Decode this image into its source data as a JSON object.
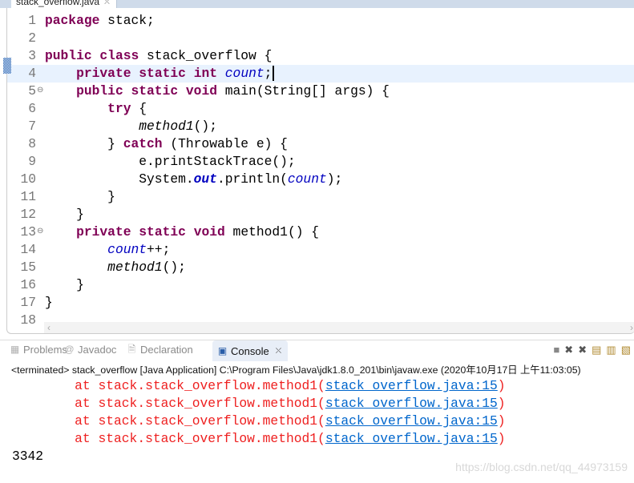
{
  "editor_tab": {
    "title": "stack_overflow.java",
    "close": "⛌"
  },
  "code": [
    {
      "n": "1",
      "t": [
        [
          "package",
          "kw"
        ],
        [
          " stack;",
          ""
        ]
      ]
    },
    {
      "n": "2",
      "t": []
    },
    {
      "n": "3",
      "t": [
        [
          "public",
          "kw"
        ],
        [
          " ",
          ""
        ],
        [
          "class",
          "kw"
        ],
        [
          " stack_overflow {",
          ""
        ]
      ]
    },
    {
      "n": "4",
      "cur": true,
      "t": [
        [
          "    ",
          ""
        ],
        [
          "private",
          "kw"
        ],
        [
          " ",
          ""
        ],
        [
          "static",
          "kw"
        ],
        [
          " ",
          ""
        ],
        [
          "int",
          "kw"
        ],
        [
          " ",
          ""
        ],
        [
          "count",
          "fld"
        ],
        [
          ";",
          ""
        ]
      ]
    },
    {
      "n": "5",
      "fold": true,
      "t": [
        [
          "    ",
          ""
        ],
        [
          "public",
          "kw"
        ],
        [
          " ",
          ""
        ],
        [
          "static",
          "kw"
        ],
        [
          " ",
          ""
        ],
        [
          "void",
          "kw"
        ],
        [
          " main(String[] args) {",
          ""
        ]
      ]
    },
    {
      "n": "6",
      "t": [
        [
          "        ",
          ""
        ],
        [
          "try",
          "kw"
        ],
        [
          " {",
          ""
        ]
      ]
    },
    {
      "n": "7",
      "t": [
        [
          "            ",
          ""
        ],
        [
          "method1",
          "it"
        ],
        [
          "();",
          ""
        ]
      ]
    },
    {
      "n": "8",
      "t": [
        [
          "        } ",
          ""
        ],
        [
          "catch",
          "kw"
        ],
        [
          " (Throwable e) {",
          ""
        ]
      ]
    },
    {
      "n": "9",
      "t": [
        [
          "            e.printStackTrace();",
          ""
        ]
      ]
    },
    {
      "n": "10",
      "t": [
        [
          "            System.",
          ""
        ],
        [
          "out",
          "sfld"
        ],
        [
          ".println(",
          ""
        ],
        [
          "count",
          "fld"
        ],
        [
          ");",
          ""
        ]
      ]
    },
    {
      "n": "11",
      "t": [
        [
          "        }",
          ""
        ]
      ]
    },
    {
      "n": "12",
      "t": [
        [
          "    }",
          ""
        ]
      ]
    },
    {
      "n": "13",
      "fold": true,
      "t": [
        [
          "    ",
          ""
        ],
        [
          "private",
          "kw"
        ],
        [
          " ",
          ""
        ],
        [
          "static",
          "kw"
        ],
        [
          " ",
          ""
        ],
        [
          "void",
          "kw"
        ],
        [
          " method1() {",
          ""
        ]
      ]
    },
    {
      "n": "14",
      "t": [
        [
          "        ",
          ""
        ],
        [
          "count",
          "fld"
        ],
        [
          "++;",
          ""
        ]
      ]
    },
    {
      "n": "15",
      "t": [
        [
          "        ",
          ""
        ],
        [
          "method1",
          "it"
        ],
        [
          "();",
          ""
        ]
      ]
    },
    {
      "n": "16",
      "t": [
        [
          "    }",
          ""
        ]
      ]
    },
    {
      "n": "17",
      "t": [
        [
          "}",
          ""
        ]
      ]
    },
    {
      "n": "18",
      "t": []
    }
  ],
  "panel": {
    "tabs": [
      {
        "label": "Problems",
        "icon": "problems-icon",
        "glyph": "▦"
      },
      {
        "label": "Javadoc",
        "icon": "javadoc-icon",
        "glyph": "@"
      },
      {
        "label": "Declaration",
        "icon": "declaration-icon",
        "glyph": "🗎"
      },
      {
        "label": "Console",
        "icon": "console-icon",
        "glyph": "▣",
        "active": true
      }
    ],
    "close": "⛌",
    "tools": [
      {
        "name": "terminate-icon",
        "g": "■"
      },
      {
        "name": "remove-launch-icon",
        "g": "✖"
      },
      {
        "name": "remove-all-icon",
        "g": "✖"
      },
      {
        "name": "clear-console-icon",
        "g": "▤"
      },
      {
        "name": "scroll-lock-icon",
        "g": "▥"
      },
      {
        "name": "word-wrap-icon",
        "g": "▧"
      }
    ],
    "status": "<terminated> stack_overflow [Java Application] C:\\Program Files\\Java\\jdk1.8.0_201\\bin\\javaw.exe (2020年10月17日 上午11:03:05)"
  },
  "console": {
    "trace": [
      {
        "prefix": "        at stack.stack_overflow.method1(",
        "link": "stack_overflow.java:15",
        "suffix": ")"
      },
      {
        "prefix": "        at stack.stack_overflow.method1(",
        "link": "stack_overflow.java:15",
        "suffix": ")"
      },
      {
        "prefix": "        at stack.stack_overflow.method1(",
        "link": "stack_overflow.java:15",
        "suffix": ")"
      },
      {
        "prefix": "        at stack.stack_overflow.method1(",
        "link": "stack_overflow.java:15",
        "suffix": ")"
      }
    ],
    "output": "3342"
  },
  "watermark": "https://blog.csdn.net/qq_44973159",
  "colors": {
    "keyword": "#7f0055",
    "field": "#0000c0",
    "error": "#ee2020",
    "link": "#0066cc"
  }
}
